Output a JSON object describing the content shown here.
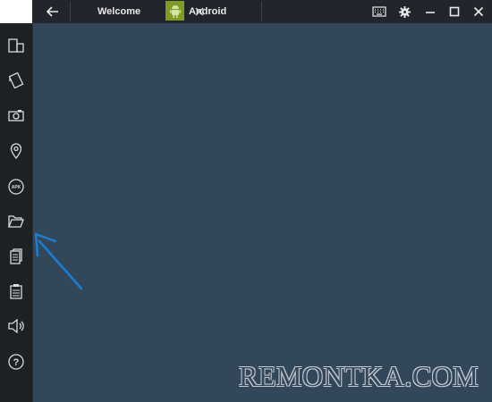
{
  "topbar": {
    "tabs": [
      {
        "label": "Welcome",
        "icon": "android-icon-none"
      },
      {
        "label": "Android",
        "icon": "android-robot-icon"
      }
    ],
    "icons": [
      "back-arrow-icon",
      "close-icon",
      "android-robot-icon",
      "keyboard-icon",
      "gear-icon",
      "minimize-icon",
      "maximize-icon",
      "close-icon"
    ]
  },
  "sidebar": {
    "items": [
      {
        "name": "screen-switch-icon"
      },
      {
        "name": "rotate-icon"
      },
      {
        "name": "camera-icon"
      },
      {
        "name": "location-pin-icon"
      },
      {
        "name": "apk-icon",
        "label": "APK"
      },
      {
        "name": "folder-open-icon"
      },
      {
        "name": "copy-icon"
      },
      {
        "name": "paste-icon"
      },
      {
        "name": "volume-icon"
      },
      {
        "name": "help-icon",
        "label": "?"
      }
    ]
  },
  "watermark": {
    "text": "REMONTKA.COM"
  },
  "colors": {
    "background": "#33475a",
    "topbar": "#22262c",
    "sidebar": "#1d2126",
    "android_green": "#7e9b24",
    "arrow": "#1a7fd4"
  }
}
